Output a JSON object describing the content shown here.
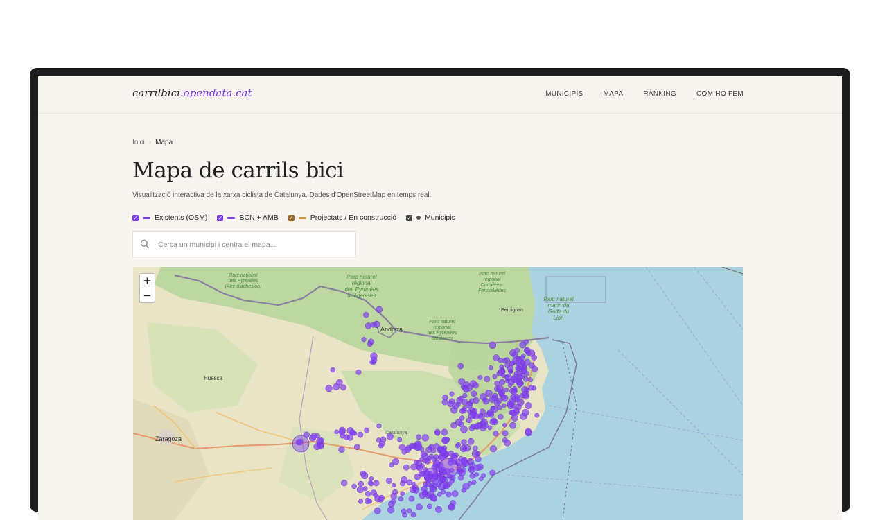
{
  "colors": {
    "accent": "#7c3aed",
    "projected": "#c8913a",
    "municipis": "#555555",
    "sea": "#aad3df",
    "land": "#e9e4c6",
    "forest": "#b7d59a",
    "bikePoint": "#8240f0"
  },
  "header": {
    "logo_main": "carrilbici",
    "logo_accent": ".opendata.cat",
    "nav": [
      "MUNICIPIS",
      "MAPA",
      "RÀNKING",
      "COM HO FEM"
    ]
  },
  "breadcrumb": {
    "home": "Inici",
    "separator": "›",
    "current": "Mapa"
  },
  "page": {
    "title": "Mapa de carrils bici",
    "subtitle": "Visualització interactiva de la xarxa ciclista de Catalunya. Dades d'OpenStreetMap en temps real."
  },
  "legend": [
    {
      "label": "Existents (OSM)",
      "checked": true,
      "kind": "line",
      "color": "#7c3aed"
    },
    {
      "label": "BCN + AMB",
      "checked": true,
      "kind": "line",
      "color": "#7c3aed"
    },
    {
      "label": "Projectats / En construcció",
      "checked": true,
      "kind": "line",
      "color": "#c8913a"
    },
    {
      "label": "Municipis",
      "checked": true,
      "kind": "dot",
      "color": "#555555"
    }
  ],
  "search": {
    "placeholder": "Cerca un municipi i centra el mapa...",
    "icon": "search-icon"
  },
  "map": {
    "zoom_in": "+",
    "zoom_out": "−",
    "labels": {
      "huesca": "Huesca",
      "zaragoza": "Zaragoza",
      "andorra": "Andorra",
      "perpignan": "Perpignan",
      "catalunya": "Catalunya",
      "pn_pyrenees_1": "Parc national",
      "pn_pyrenees_2": "des Pyrénées",
      "pn_pyrenees_3": "(Aire d'adhésion)",
      "prp_1": "Parc naturel",
      "prp_2": "régional",
      "prp_3": "des Pyrénées",
      "prp_4": "ariégeoises",
      "prc_1": "Parc naturel",
      "prc_2": "régional",
      "prc_3": "Corbières-",
      "prc_4": "Fenouillèdes",
      "prcat_1": "Parc naturel",
      "prcat_2": "régional",
      "prcat_3": "des Pyrénées",
      "prcat_4": "catalanes",
      "marine_1": "Parc naturel",
      "marine_2": "marin du",
      "marine_3": "Golfe du",
      "marine_4": "Lion"
    }
  }
}
